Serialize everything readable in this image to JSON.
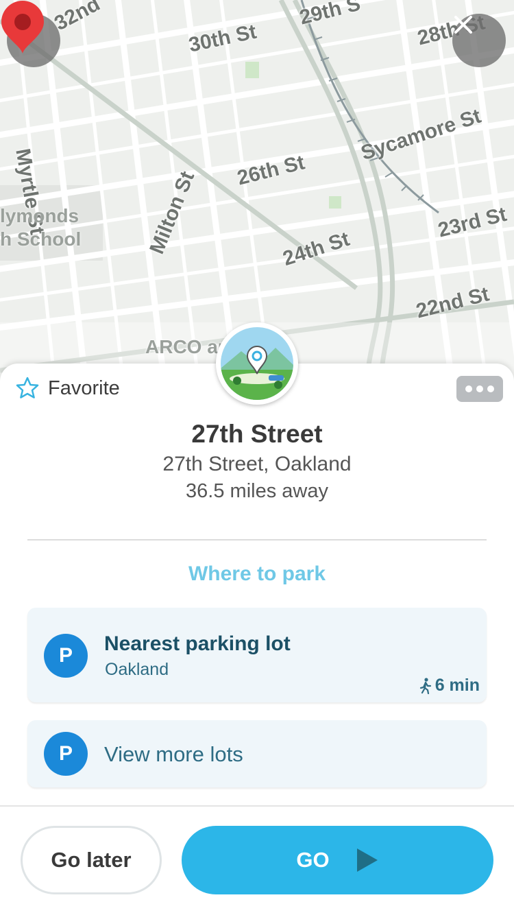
{
  "map": {
    "street_labels": [
      "32nd",
      "30th St",
      "29th S",
      "28th St",
      "Myrtle St",
      "Sycamore St",
      "26th St",
      "Milton St",
      "23rd St",
      "24th St",
      "22nd St",
      "ARCO ar"
    ],
    "place_line1": "lymonds",
    "place_line2": "h School",
    "back_icon": "chevron-left-icon",
    "close_icon": "close-icon",
    "pin_color": "#e8393a"
  },
  "sheet": {
    "favorite_label": "Favorite",
    "title": "27th Street",
    "address": "27th Street, Oakland",
    "distance": "36.5 miles away",
    "park_heading": "Where to park"
  },
  "parking": {
    "nearest": {
      "badge": "P",
      "name": "Nearest parking lot",
      "city": "Oakland",
      "walk_time": "6 min"
    },
    "more": {
      "badge": "P",
      "label": "View more lots"
    }
  },
  "actions": {
    "go_later": "Go later",
    "go": "GO"
  },
  "colors": {
    "accent": "#2cb6e8",
    "park_heading": "#6fc8e6",
    "parking_badge": "#1b89d9"
  }
}
